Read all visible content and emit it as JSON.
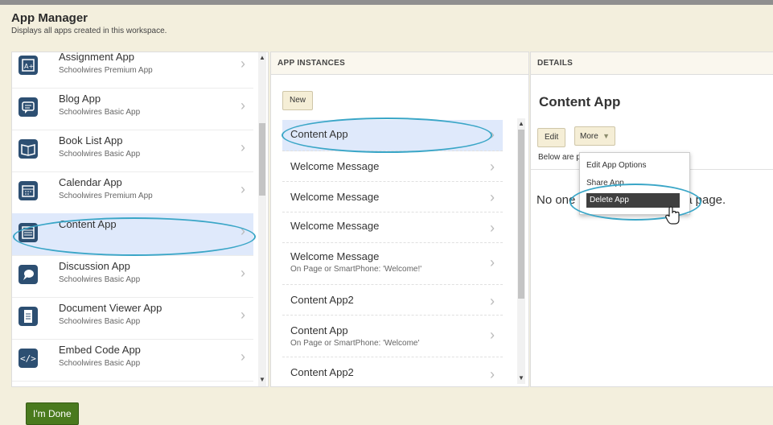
{
  "header": {
    "title": "App Manager",
    "subtitle": "Displays all apps created in this workspace."
  },
  "apps": [
    {
      "name": "Assignment App",
      "type": "Schoolwires Premium App",
      "icon": "assignment-icon"
    },
    {
      "name": "Blog App",
      "type": "Schoolwires Basic App",
      "icon": "blog-icon"
    },
    {
      "name": "Book List App",
      "type": "Schoolwires Basic App",
      "icon": "book-icon"
    },
    {
      "name": "Calendar App",
      "type": "Schoolwires Premium App",
      "icon": "calendar-icon"
    },
    {
      "name": "Content App",
      "type": "",
      "icon": "content-icon"
    },
    {
      "name": "Discussion App",
      "type": "Schoolwires Basic App",
      "icon": "discussion-icon"
    },
    {
      "name": "Document Viewer App",
      "type": "Schoolwires Basic App",
      "icon": "document-icon"
    },
    {
      "name": "Embed Code App",
      "type": "Schoolwires Basic App",
      "icon": "code-icon"
    }
  ],
  "instances": {
    "header": "APP INSTANCES",
    "new_label": "New",
    "items": [
      {
        "label": "Content App",
        "sub": ""
      },
      {
        "label": "Welcome Message",
        "sub": ""
      },
      {
        "label": "Welcome Message",
        "sub": ""
      },
      {
        "label": "Welcome Message",
        "sub": ""
      },
      {
        "label": "Welcome Message",
        "sub": "On Page or SmartPhone: 'Welcome!'"
      },
      {
        "label": "Content App2",
        "sub": ""
      },
      {
        "label": "Content App",
        "sub": "On Page or SmartPhone: 'Welcome'"
      },
      {
        "label": "Content App2",
        "sub": ""
      }
    ]
  },
  "details": {
    "header": "DETAILS",
    "title": "Content App",
    "edit_label": "Edit",
    "more_label": "More",
    "below_text": "Below are pages that use this App.",
    "no_one_text": "No one is using this app on a page."
  },
  "more_menu": {
    "items": [
      "Edit App Options",
      "Share App",
      "Delete App"
    ]
  },
  "footer": {
    "done_label": "I'm Done"
  },
  "colors": {
    "accent": "#3aa6c7",
    "selected_bg": "#dfe9fb",
    "done_button": "#4a7a1e",
    "header_bg": "#f3efdd"
  }
}
